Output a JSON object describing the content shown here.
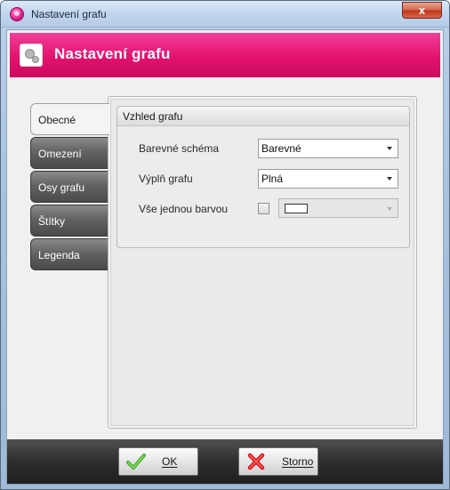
{
  "window": {
    "title": "Nastavení grafu",
    "close_glyph": "x"
  },
  "header": {
    "title": "Nastavení grafu",
    "icon": "gears-icon",
    "accent_color": "#e2126f"
  },
  "tabs": [
    {
      "label": "Obecné",
      "active": true
    },
    {
      "label": "Omezení",
      "active": false
    },
    {
      "label": "Osy grafu",
      "active": false
    },
    {
      "label": "Štítky",
      "active": false
    },
    {
      "label": "Legenda",
      "active": false
    }
  ],
  "group": {
    "title": "Vzhled grafu",
    "color_scheme": {
      "label": "Barevné schéma",
      "value": "Barevné"
    },
    "fill": {
      "label": "Výplň grafu",
      "value": "Plná"
    },
    "single_color": {
      "label": "Vše jednou barvou",
      "checked": false,
      "swatch_color": "#ffffff"
    }
  },
  "footer": {
    "ok_label": "OK",
    "cancel_label": "Storno"
  }
}
